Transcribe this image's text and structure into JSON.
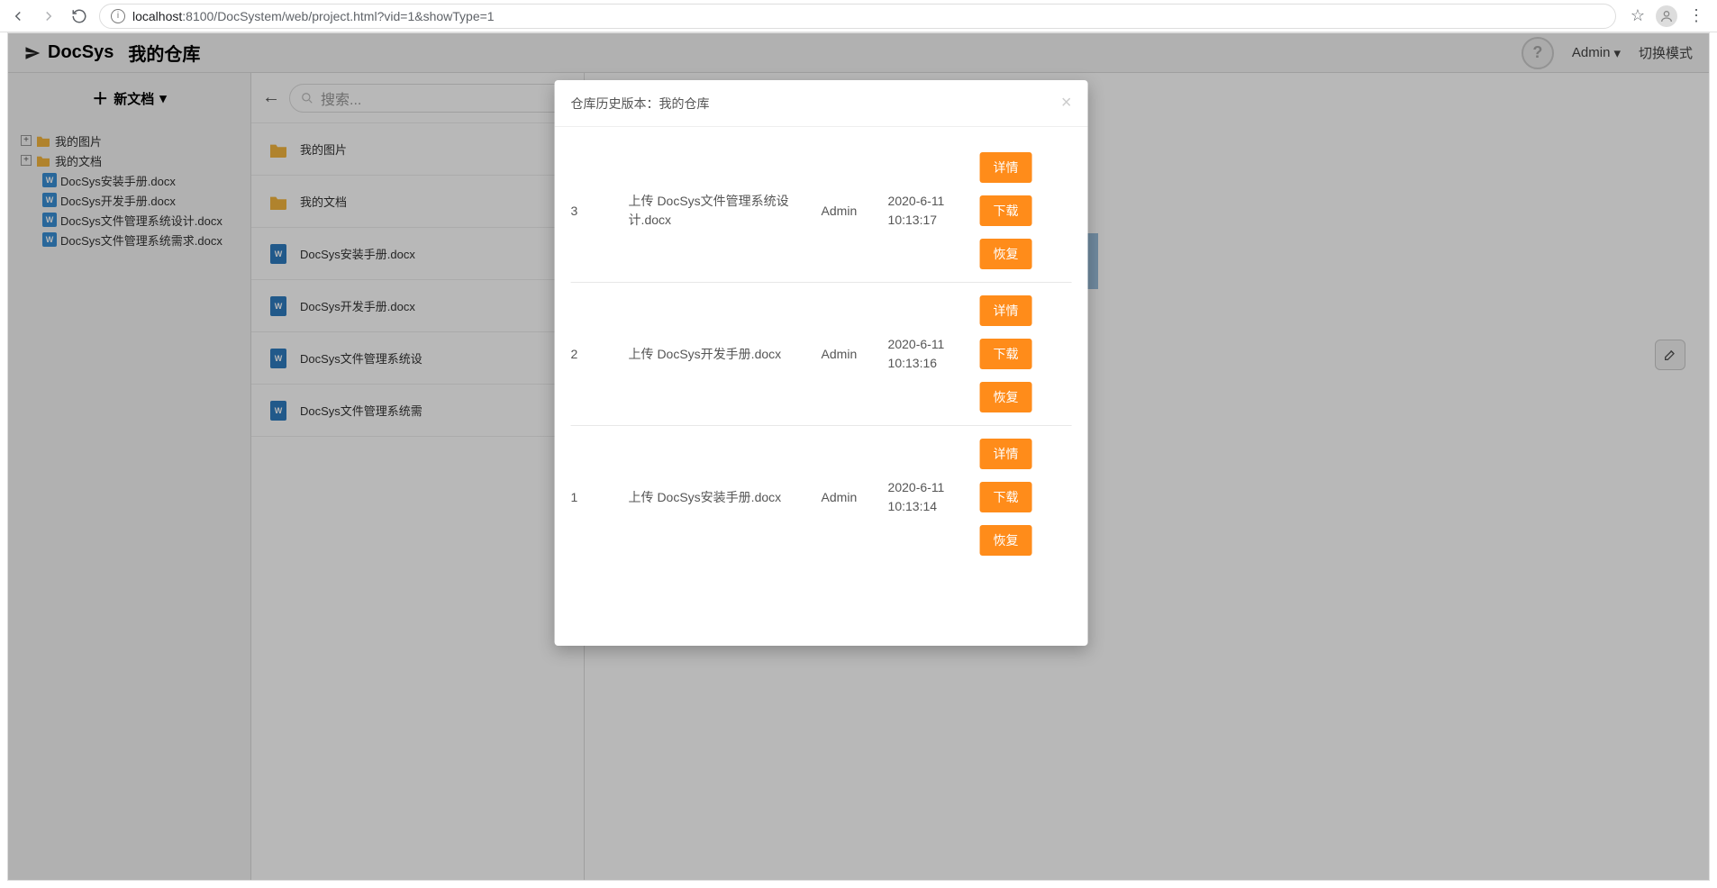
{
  "browser": {
    "url_host": "localhost",
    "url_port_path": ":8100/DocSystem/web/project.html?vid=1&showType=1"
  },
  "header": {
    "brand": "DocSys",
    "repo_title": "我的仓库",
    "user": "Admin",
    "switch_mode": "切换模式"
  },
  "sidebar": {
    "new_doc": "新文档",
    "tree": {
      "folder1": "我的图片",
      "folder2": "我的文档",
      "leaf1": "DocSys安装手册.docx",
      "leaf2": "DocSys开发手册.docx",
      "leaf3": "DocSys文件管理系统设计.docx",
      "leaf4": "DocSys文件管理系统需求.docx"
    }
  },
  "search": {
    "placeholder": "搜索..."
  },
  "filelist": [
    {
      "type": "folder",
      "name": "我的图片"
    },
    {
      "type": "folder",
      "name": "我的文档"
    },
    {
      "type": "word",
      "name": "DocSys安装手册.docx"
    },
    {
      "type": "word",
      "name": "DocSys开发手册.docx"
    },
    {
      "type": "word",
      "name": "DocSys文件管理系统设"
    },
    {
      "type": "word",
      "name": "DocSys文件管理系统需"
    }
  ],
  "modal": {
    "title": "仓库历史版本：我的仓库",
    "btn_detail": "详情",
    "btn_download": "下载",
    "btn_restore": "恢复",
    "rows": [
      {
        "idx": "3",
        "desc": "上传 DocSys文件管理系统设计.docx",
        "user": "Admin",
        "time": "2020-6-11 10:13:17"
      },
      {
        "idx": "2",
        "desc": "上传 DocSys开发手册.docx",
        "user": "Admin",
        "time": "2020-6-11 10:13:16"
      },
      {
        "idx": "1",
        "desc": "上传 DocSys安装手册.docx",
        "user": "Admin",
        "time": "2020-6-11 10:13:14"
      }
    ]
  }
}
